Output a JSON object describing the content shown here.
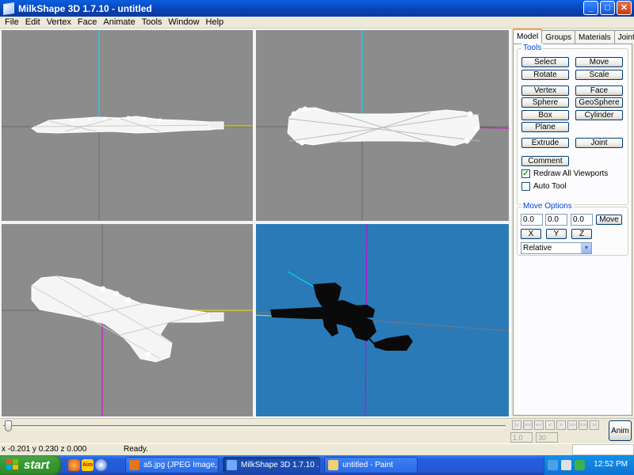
{
  "window": {
    "title": "MilkShape 3D 1.7.10 - untitled",
    "buttons": {
      "minimize": "_",
      "maximize": "□",
      "close": "✕"
    }
  },
  "menu": [
    "File",
    "Edit",
    "Vertex",
    "Face",
    "Animate",
    "Tools",
    "Window",
    "Help"
  ],
  "colors": {
    "viewport_gray": "#8c8c8c",
    "viewport_3d_blue": "#2b7ab8",
    "axis_cyan": "#00e5ff",
    "axis_magenta": "#d000d0",
    "axis_yellow": "#e6e600",
    "wire": "#ffffff",
    "accent_tab": "#f2a33c"
  },
  "panel": {
    "tabs": [
      "Model",
      "Groups",
      "Materials",
      "Joints"
    ],
    "active_tab": "Model",
    "tools_label": "Tools",
    "tools": {
      "select": "Select",
      "move": "Move",
      "rotate": "Rotate",
      "scale": "Scale",
      "vertex": "Vertex",
      "face": "Face",
      "sphere": "Sphere",
      "geosphere": "GeoSphere",
      "box": "Box",
      "cylinder": "Cylinder",
      "plane": "Plane",
      "extrude": "Extrude",
      "joint": "Joint",
      "comment": "Comment"
    },
    "redraw_label": "Redraw All Viewports",
    "redraw_checked": "✓",
    "autotool_label": "Auto Tool",
    "move_options_label": "Move Options",
    "move_x": "0.0",
    "move_y": "0.0",
    "move_z": "0.0",
    "move_button": "Move",
    "axis_x": "X",
    "axis_y": "Y",
    "axis_z": "Z",
    "mode": "Relative"
  },
  "timeline": {
    "frame_current": "1.0",
    "frame_total": "30",
    "anim_button": "Anim",
    "playback_icons": [
      "|<",
      "|<<",
      "<<",
      "<",
      ">",
      ">>",
      ">>|",
      ">|"
    ]
  },
  "status": {
    "coords": "x -0.201 y 0.230 z 0.000",
    "message": "Ready."
  },
  "taskbar": {
    "start": "start",
    "quicklaunch": [
      "firefox-icon",
      "aim-icon",
      "media-icon"
    ],
    "aim_text": "Aim",
    "tasks": [
      {
        "label": "a5.jpg (JPEG Image, ...",
        "icon_color": "#e8741a",
        "active": false
      },
      {
        "label": "MilkShape 3D 1.7.10 ...",
        "icon_color": "#6fa8ff",
        "active": true
      },
      {
        "label": "untitled - Paint",
        "icon_color": "#f0d070",
        "active": false
      }
    ],
    "clock": "12:52 PM"
  }
}
